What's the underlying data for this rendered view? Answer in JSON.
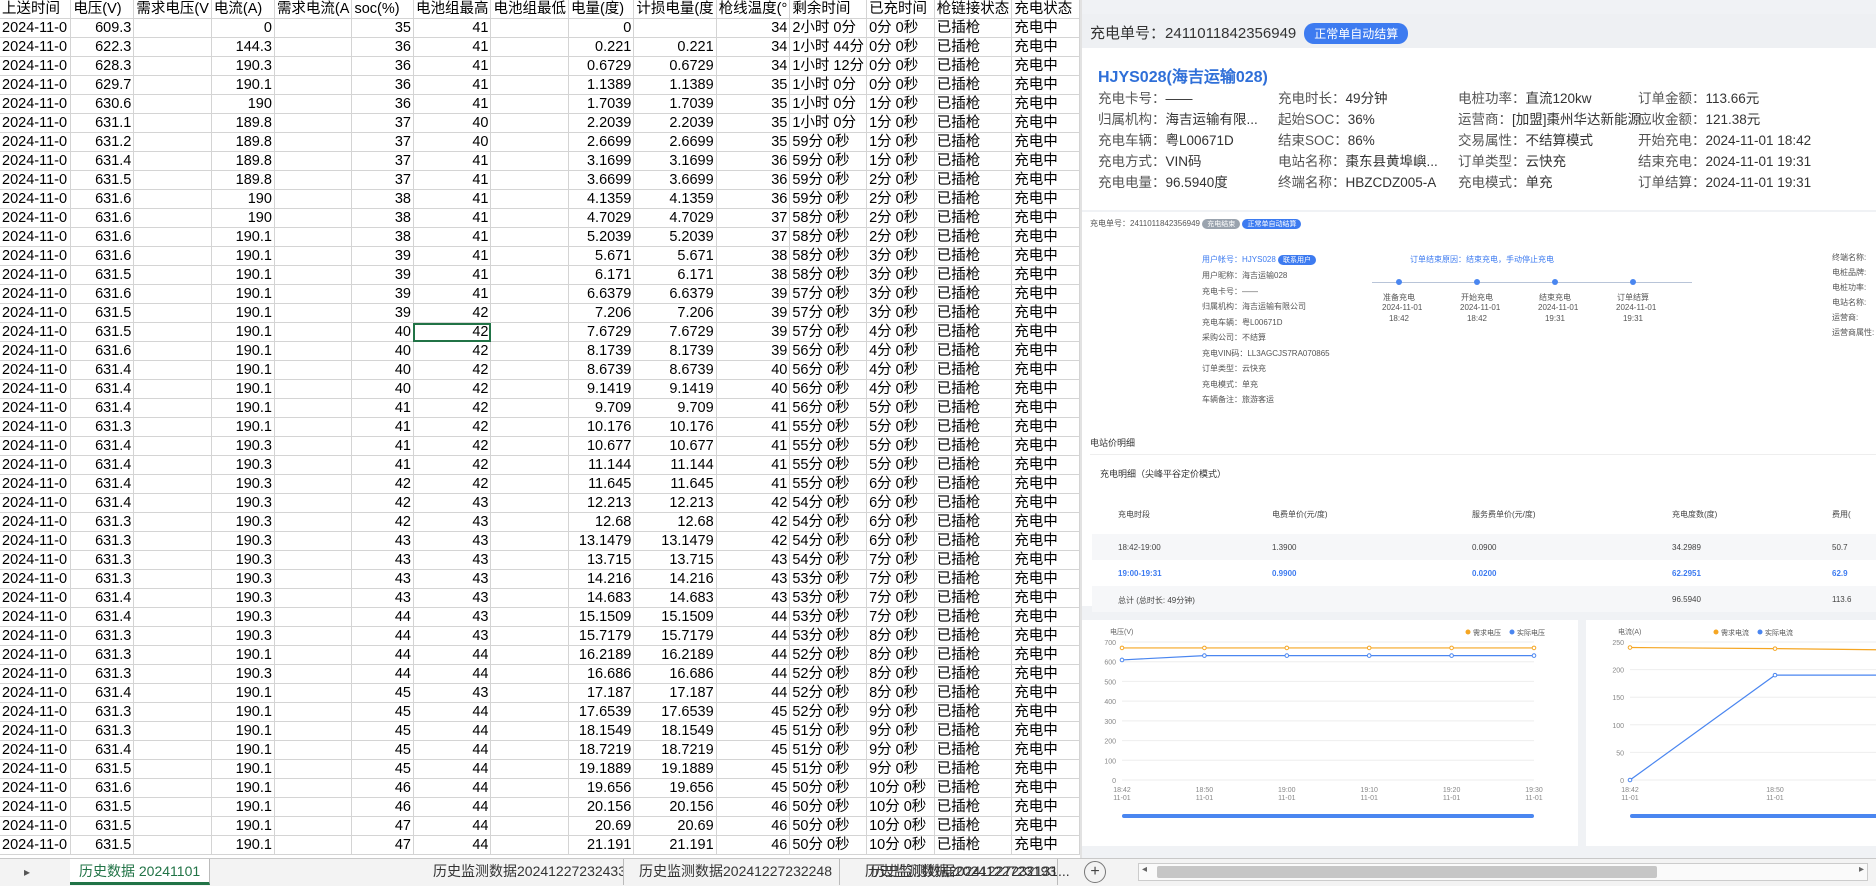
{
  "sheet": {
    "headers": [
      "上送时间",
      "电压(V)",
      "需求电压(V",
      "电流(A)",
      "需求电流(A",
      "soc(%)",
      "电池组最高",
      "电池组最低",
      "电量(度)",
      "计损电量(度",
      "枪线温度(°",
      "剩余时间",
      "已充时间",
      "枪链接状态",
      "充电状态"
    ],
    "rows": [
      [
        "2024-11-0",
        "609.3",
        "",
        "0",
        "",
        "35",
        "41",
        "",
        "0",
        "",
        "34",
        "2小时 0分",
        "0分 0秒",
        "已插枪",
        "充电中"
      ],
      [
        "2024-11-0",
        "622.3",
        "",
        "144.3",
        "",
        "36",
        "41",
        "",
        "0.221",
        "0.221",
        "34",
        "1小时 44分",
        "0分 0秒",
        "已插枪",
        "充电中"
      ],
      [
        "2024-11-0",
        "628.3",
        "",
        "190.3",
        "",
        "36",
        "41",
        "",
        "0.6729",
        "0.6729",
        "34",
        "1小时 12分",
        "0分 0秒",
        "已插枪",
        "充电中"
      ],
      [
        "2024-11-0",
        "629.7",
        "",
        "190.1",
        "",
        "36",
        "41",
        "",
        "1.1389",
        "1.1389",
        "35",
        "1小时 0分",
        "0分 0秒",
        "已插枪",
        "充电中"
      ],
      [
        "2024-11-0",
        "630.6",
        "",
        "190",
        "",
        "36",
        "41",
        "",
        "1.7039",
        "1.7039",
        "35",
        "1小时 0分",
        "1分 0秒",
        "已插枪",
        "充电中"
      ],
      [
        "2024-11-0",
        "631.1",
        "",
        "189.8",
        "",
        "37",
        "40",
        "",
        "2.2039",
        "2.2039",
        "35",
        "1小时 0分",
        "1分 0秒",
        "已插枪",
        "充电中"
      ],
      [
        "2024-11-0",
        "631.2",
        "",
        "189.8",
        "",
        "37",
        "40",
        "",
        "2.6699",
        "2.6699",
        "35",
        "59分 0秒",
        "1分 0秒",
        "已插枪",
        "充电中"
      ],
      [
        "2024-11-0",
        "631.4",
        "",
        "189.8",
        "",
        "37",
        "41",
        "",
        "3.1699",
        "3.1699",
        "36",
        "59分 0秒",
        "1分 0秒",
        "已插枪",
        "充电中"
      ],
      [
        "2024-11-0",
        "631.5",
        "",
        "189.8",
        "",
        "37",
        "41",
        "",
        "3.6699",
        "3.6699",
        "36",
        "59分 0秒",
        "2分 0秒",
        "已插枪",
        "充电中"
      ],
      [
        "2024-11-0",
        "631.6",
        "",
        "190",
        "",
        "38",
        "41",
        "",
        "4.1359",
        "4.1359",
        "36",
        "59分 0秒",
        "2分 0秒",
        "已插枪",
        "充电中"
      ],
      [
        "2024-11-0",
        "631.6",
        "",
        "190",
        "",
        "38",
        "41",
        "",
        "4.7029",
        "4.7029",
        "37",
        "58分 0秒",
        "2分 0秒",
        "已插枪",
        "充电中"
      ],
      [
        "2024-11-0",
        "631.6",
        "",
        "190.1",
        "",
        "38",
        "41",
        "",
        "5.2039",
        "5.2039",
        "37",
        "58分 0秒",
        "2分 0秒",
        "已插枪",
        "充电中"
      ],
      [
        "2024-11-0",
        "631.6",
        "",
        "190.1",
        "",
        "39",
        "41",
        "",
        "5.671",
        "5.671",
        "38",
        "58分 0秒",
        "3分 0秒",
        "已插枪",
        "充电中"
      ],
      [
        "2024-11-0",
        "631.5",
        "",
        "190.1",
        "",
        "39",
        "41",
        "",
        "6.171",
        "6.171",
        "38",
        "58分 0秒",
        "3分 0秒",
        "已插枪",
        "充电中"
      ],
      [
        "2024-11-0",
        "631.6",
        "",
        "190.1",
        "",
        "39",
        "41",
        "",
        "6.6379",
        "6.6379",
        "39",
        "57分 0秒",
        "3分 0秒",
        "已插枪",
        "充电中"
      ],
      [
        "2024-11-0",
        "631.5",
        "",
        "190.1",
        "",
        "39",
        "42",
        "",
        "7.206",
        "7.206",
        "39",
        "57分 0秒",
        "3分 0秒",
        "已插枪",
        "充电中"
      ],
      [
        "2024-11-0",
        "631.5",
        "",
        "190.1",
        "",
        "40",
        "42",
        "",
        "7.6729",
        "7.6729",
        "39",
        "57分 0秒",
        "4分 0秒",
        "已插枪",
        "充电中"
      ],
      [
        "2024-11-0",
        "631.6",
        "",
        "190.1",
        "",
        "40",
        "42",
        "",
        "8.1739",
        "8.1739",
        "39",
        "56分 0秒",
        "4分 0秒",
        "已插枪",
        "充电中"
      ],
      [
        "2024-11-0",
        "631.4",
        "",
        "190.1",
        "",
        "40",
        "42",
        "",
        "8.6739",
        "8.6739",
        "40",
        "56分 0秒",
        "4分 0秒",
        "已插枪",
        "充电中"
      ],
      [
        "2024-11-0",
        "631.4",
        "",
        "190.1",
        "",
        "40",
        "42",
        "",
        "9.1419",
        "9.1419",
        "40",
        "56分 0秒",
        "4分 0秒",
        "已插枪",
        "充电中"
      ],
      [
        "2024-11-0",
        "631.4",
        "",
        "190.1",
        "",
        "41",
        "42",
        "",
        "9.709",
        "9.709",
        "41",
        "56分 0秒",
        "5分 0秒",
        "已插枪",
        "充电中"
      ],
      [
        "2024-11-0",
        "631.3",
        "",
        "190.1",
        "",
        "41",
        "42",
        "",
        "10.176",
        "10.176",
        "41",
        "55分 0秒",
        "5分 0秒",
        "已插枪",
        "充电中"
      ],
      [
        "2024-11-0",
        "631.4",
        "",
        "190.3",
        "",
        "41",
        "42",
        "",
        "10.677",
        "10.677",
        "41",
        "55分 0秒",
        "5分 0秒",
        "已插枪",
        "充电中"
      ],
      [
        "2024-11-0",
        "631.4",
        "",
        "190.3",
        "",
        "41",
        "42",
        "",
        "11.144",
        "11.144",
        "41",
        "55分 0秒",
        "5分 0秒",
        "已插枪",
        "充电中"
      ],
      [
        "2024-11-0",
        "631.4",
        "",
        "190.3",
        "",
        "42",
        "42",
        "",
        "11.645",
        "11.645",
        "41",
        "55分 0秒",
        "6分 0秒",
        "已插枪",
        "充电中"
      ],
      [
        "2024-11-0",
        "631.4",
        "",
        "190.3",
        "",
        "42",
        "43",
        "",
        "12.213",
        "12.213",
        "42",
        "54分 0秒",
        "6分 0秒",
        "已插枪",
        "充电中"
      ],
      [
        "2024-11-0",
        "631.3",
        "",
        "190.3",
        "",
        "42",
        "43",
        "",
        "12.68",
        "12.68",
        "42",
        "54分 0秒",
        "6分 0秒",
        "已插枪",
        "充电中"
      ],
      [
        "2024-11-0",
        "631.3",
        "",
        "190.3",
        "",
        "43",
        "43",
        "",
        "13.1479",
        "13.1479",
        "42",
        "54分 0秒",
        "6分 0秒",
        "已插枪",
        "充电中"
      ],
      [
        "2024-11-0",
        "631.3",
        "",
        "190.3",
        "",
        "43",
        "43",
        "",
        "13.715",
        "13.715",
        "43",
        "54分 0秒",
        "7分 0秒",
        "已插枪",
        "充电中"
      ],
      [
        "2024-11-0",
        "631.3",
        "",
        "190.3",
        "",
        "43",
        "43",
        "",
        "14.216",
        "14.216",
        "43",
        "53分 0秒",
        "7分 0秒",
        "已插枪",
        "充电中"
      ],
      [
        "2024-11-0",
        "631.4",
        "",
        "190.3",
        "",
        "43",
        "43",
        "",
        "14.683",
        "14.683",
        "43",
        "53分 0秒",
        "7分 0秒",
        "已插枪",
        "充电中"
      ],
      [
        "2024-11-0",
        "631.4",
        "",
        "190.3",
        "",
        "44",
        "43",
        "",
        "15.1509",
        "15.1509",
        "44",
        "53分 0秒",
        "7分 0秒",
        "已插枪",
        "充电中"
      ],
      [
        "2024-11-0",
        "631.3",
        "",
        "190.3",
        "",
        "44",
        "43",
        "",
        "15.7179",
        "15.7179",
        "44",
        "53分 0秒",
        "8分 0秒",
        "已插枪",
        "充电中"
      ],
      [
        "2024-11-0",
        "631.3",
        "",
        "190.1",
        "",
        "44",
        "44",
        "",
        "16.2189",
        "16.2189",
        "44",
        "52分 0秒",
        "8分 0秒",
        "已插枪",
        "充电中"
      ],
      [
        "2024-11-0",
        "631.3",
        "",
        "190.3",
        "",
        "44",
        "44",
        "",
        "16.686",
        "16.686",
        "44",
        "52分 0秒",
        "8分 0秒",
        "已插枪",
        "充电中"
      ],
      [
        "2024-11-0",
        "631.4",
        "",
        "190.1",
        "",
        "45",
        "43",
        "",
        "17.187",
        "17.187",
        "44",
        "52分 0秒",
        "8分 0秒",
        "已插枪",
        "充电中"
      ],
      [
        "2024-11-0",
        "631.3",
        "",
        "190.1",
        "",
        "45",
        "44",
        "",
        "17.6539",
        "17.6539",
        "45",
        "52分 0秒",
        "9分 0秒",
        "已插枪",
        "充电中"
      ],
      [
        "2024-11-0",
        "631.3",
        "",
        "190.1",
        "",
        "45",
        "44",
        "",
        "18.1549",
        "18.1549",
        "45",
        "51分 0秒",
        "9分 0秒",
        "已插枪",
        "充电中"
      ],
      [
        "2024-11-0",
        "631.4",
        "",
        "190.1",
        "",
        "45",
        "44",
        "",
        "18.7219",
        "18.7219",
        "45",
        "51分 0秒",
        "9分 0秒",
        "已插枪",
        "充电中"
      ],
      [
        "2024-11-0",
        "631.5",
        "",
        "190.1",
        "",
        "45",
        "44",
        "",
        "19.1889",
        "19.1889",
        "45",
        "51分 0秒",
        "9分 0秒",
        "已插枪",
        "充电中"
      ],
      [
        "2024-11-0",
        "631.6",
        "",
        "190.1",
        "",
        "46",
        "44",
        "",
        "19.656",
        "19.656",
        "45",
        "50分 0秒",
        "10分 0秒",
        "已插枪",
        "充电中"
      ],
      [
        "2024-11-0",
        "631.5",
        "",
        "190.1",
        "",
        "46",
        "44",
        "",
        "20.156",
        "20.156",
        "46",
        "50分 0秒",
        "10分 0秒",
        "已插枪",
        "充电中"
      ],
      [
        "2024-11-0",
        "631.5",
        "",
        "190.1",
        "",
        "47",
        "44",
        "",
        "20.69",
        "20.69",
        "46",
        "50分 0秒",
        "10分 0秒",
        "已插枪",
        "充电中"
      ],
      [
        "2024-11-0",
        "631.5",
        "",
        "190.1",
        "",
        "47",
        "44",
        "",
        "21.191",
        "21.191",
        "46",
        "50分 0秒",
        "10分 0秒",
        "已插枪",
        "充电中"
      ]
    ]
  },
  "sheet_tabs": [
    "历史数据 20241101",
    "历史监测数据20241227232433",
    "历史监测数据20241227232248",
    "历史监测数据20241227232131",
    "历史监测数据2024122723193"
  ],
  "sheet_tabs_more": "...",
  "sheet_add": "+",
  "panel": {
    "order_label": "充电单号：",
    "order_no": "2411011842356949",
    "order_badge": "正常单自动结算",
    "car_name": "HJYS028(海吉运输028)",
    "fields": [
      [
        "充电卡号：",
        "——"
      ],
      [
        "充电时长：",
        "49分钟"
      ],
      [
        "电桩功率：",
        "直流120kw"
      ],
      [
        "订单金额：",
        "113.66元"
      ],
      [
        "归属机构：",
        "海吉运输有限..."
      ],
      [
        "起始SOC：",
        "36%"
      ],
      [
        "运营商：",
        "[加盟]棗州华达新能源..."
      ],
      [
        "应收金额：",
        "121.38元"
      ],
      [
        "充电车辆：",
        "粤L00671D"
      ],
      [
        "结束SOC：",
        "86%"
      ],
      [
        "交易属性：",
        "不结算模式"
      ],
      [
        "开始充电：",
        "2024-11-01 18:42"
      ],
      [
        "充电方式：",
        "VIN码"
      ],
      [
        "电站名称：",
        "棗东县黄埠嶼..."
      ],
      [
        "订单类型：",
        "云快充"
      ],
      [
        "结束充电：",
        "2024-11-01 19:31"
      ],
      [
        "充电电量：",
        "96.5940度"
      ],
      [
        "终端名称：",
        "HBZCDZ005-A"
      ],
      [
        "充电模式：",
        "单充"
      ],
      [
        "订单结算：",
        "2024-11-01 19:31"
      ]
    ],
    "detail": {
      "order_line": "充电单号：2411011842356949",
      "badge1": "充电结束",
      "badge2": "正常单自动结算",
      "user_label": "用户帐号：HJYS028",
      "contact_btn": "联系用户",
      "info": [
        "用户昵称：海吉运输028",
        "充电卡号：——",
        "归属机构：海吉运输有限公司",
        "充电车辆：粤L00671D",
        "采购公司：不结算",
        "充电VIN码：LL3AGCJS7RA070865",
        "订单类型：云快充",
        "充电模式：单充",
        "车辆备注：旅游客运"
      ],
      "end_reason": "订单结束原因：结束充电，手动停止充电",
      "steps": [
        [
          "准备充电",
          "2024-11-01",
          "18:42"
        ],
        [
          "开始充电",
          "2024-11-01",
          "18:42"
        ],
        [
          "结束充电",
          "2024-11-01",
          "19:31"
        ],
        [
          "订单结算",
          "2024-11-01",
          "19:31"
        ]
      ],
      "right_labels": [
        "终端名称:",
        "电桩品牌:",
        "电桩功率:",
        "电站名称:",
        "运营商:",
        "运营商属性:"
      ]
    },
    "price": {
      "section_title": "电站价明细",
      "sub_title": "充电明细（尖峰平谷定价模式）",
      "headers": [
        "充电时段",
        "电费单价(元/度)",
        "服务费单价(元/度)",
        "充电度数(度)",
        "费用("
      ],
      "rows": [
        [
          "18:42-19:00",
          "1.3900",
          "0.0900",
          "34.2989",
          "50.7"
        ],
        [
          "19:00-19:31",
          "0.9900",
          "0.0200",
          "62.2951",
          "62.9"
        ]
      ],
      "total": [
        "总计 (总时长: 49分钟)",
        "96.5940",
        "113.6"
      ]
    }
  },
  "chart_data": [
    {
      "type": "line",
      "title": "",
      "ylabel": "电压(V)",
      "ylim": [
        0,
        700
      ],
      "yticks": [
        0,
        100,
        200,
        300,
        400,
        500,
        600,
        700
      ],
      "x": [
        "18:42\n11-01",
        "18:50\n11-01",
        "19:00\n11-01",
        "19:10\n11-01",
        "19:20\n11-01",
        "19:30\n11-01"
      ],
      "series": [
        {
          "name": "需求电压",
          "color": "#f5a623",
          "values": [
            670,
            670,
            670,
            670,
            670,
            670
          ]
        },
        {
          "name": "实际电压",
          "color": "#4a86f0",
          "values": [
            609,
            631,
            631,
            631,
            631,
            631
          ]
        }
      ]
    },
    {
      "type": "line",
      "title": "",
      "ylabel": "电流(A)",
      "ylim": [
        0,
        250
      ],
      "yticks": [
        0,
        50,
        100,
        150,
        200,
        250
      ],
      "x": [
        "18:42\n11-01",
        "18:50\n11-01",
        "19:"
      ],
      "series": [
        {
          "name": "需求电流",
          "color": "#f5a623",
          "values": [
            240,
            238,
            235
          ]
        },
        {
          "name": "实际电流",
          "color": "#4a86f0",
          "values": [
            0,
            190,
            190
          ]
        }
      ]
    }
  ]
}
